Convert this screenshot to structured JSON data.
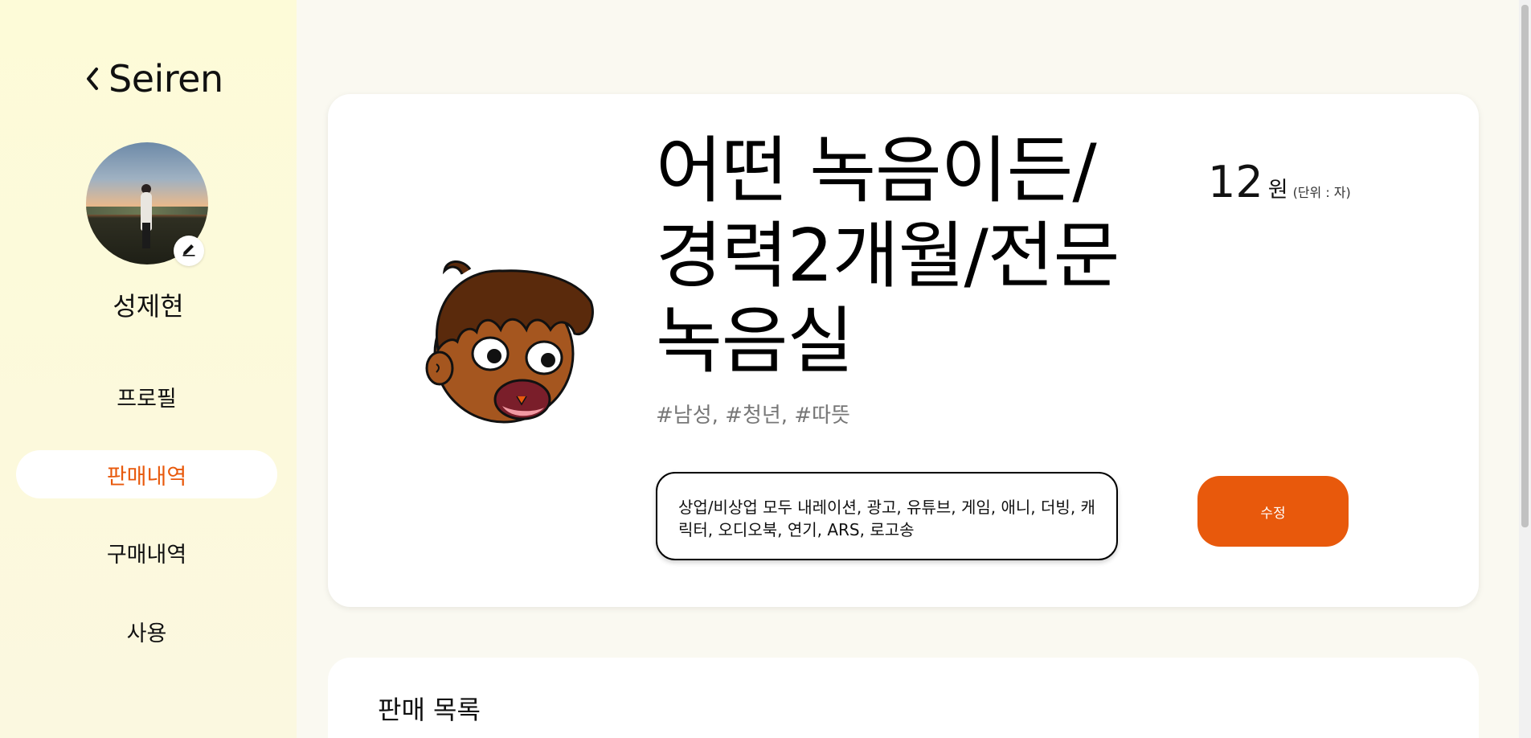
{
  "sidebar": {
    "brand": "Seiren",
    "username": "성제현",
    "nav": [
      {
        "label": "프로필",
        "active": false
      },
      {
        "label": "판매내역",
        "active": true
      },
      {
        "label": "구매내역",
        "active": false
      },
      {
        "label": "사용",
        "active": false
      }
    ]
  },
  "product": {
    "title": "어떤 녹음이든/경력2개월/전문녹음실",
    "price": "12",
    "price_unit": "원",
    "price_note": "(단위 : 자)",
    "tags": "#남성, #청년, #따뜻",
    "description": "상업/비상업 모두 내레이션, 광고, 유튜브, 게임, 애니, 더빙, 캐릭터, 오디오북, 연기, ARS, 로고송",
    "edit_label": "수정"
  },
  "sales_list": {
    "title": "판매 목록"
  },
  "colors": {
    "accent": "#e8590c",
    "sidebar_bg": "#fcf9dc",
    "page_bg": "#faf9f1"
  }
}
